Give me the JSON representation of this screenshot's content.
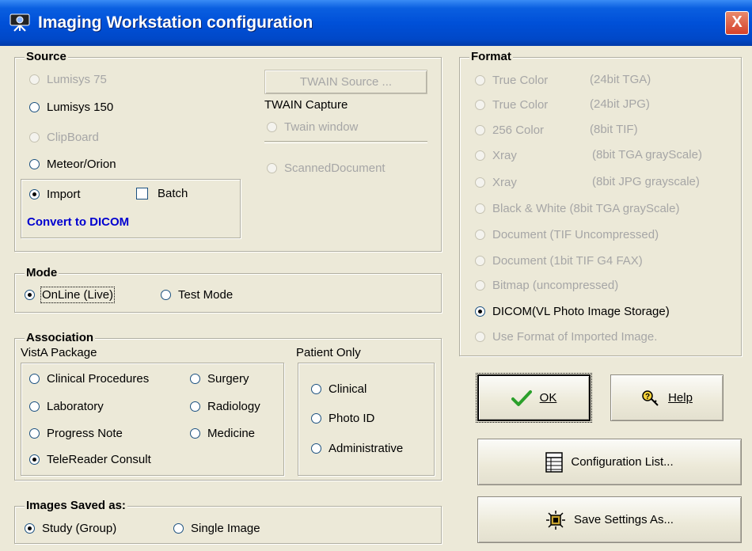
{
  "window": {
    "title": "Imaging Workstation configuration",
    "close": "X"
  },
  "source": {
    "legend": "Source",
    "options": [
      "Lumisys 75",
      "Lumisys 150",
      "ClipBoard",
      "Meteor/Orion",
      "Import"
    ],
    "batch_label": "Batch",
    "convert_label": "Convert to DICOM",
    "twain_source_button": "TWAIN Source ...",
    "twain_capture_label": "TWAIN Capture",
    "twain_window": "Twain window",
    "scanned_document": "ScannedDocument"
  },
  "format": {
    "legend": "Format",
    "options": [
      {
        "name": "True Color",
        "desc": "(24bit TGA)"
      },
      {
        "name": "True Color",
        "desc": "(24bit JPG)"
      },
      {
        "name": "256 Color",
        "desc": "(8bit TIF)"
      },
      {
        "name": "Xray",
        "desc": "(8bit TGA grayScale)"
      },
      {
        "name": "Xray",
        "desc": "(8bit JPG grayscale)"
      },
      {
        "name": "Black & White (8bit TGA grayScale)",
        "desc": ""
      },
      {
        "name": "Document (TIF Uncompressed)",
        "desc": ""
      },
      {
        "name": "Document (1bit TIF G4 FAX)",
        "desc": ""
      },
      {
        "name": "Bitmap (uncompressed)",
        "desc": ""
      },
      {
        "name": "DICOM(VL Photo Image Storage)",
        "desc": ""
      },
      {
        "name": "Use Format of Imported Image.",
        "desc": ""
      }
    ]
  },
  "mode": {
    "legend": "Mode",
    "online": "OnLine (Live)",
    "test": "Test Mode"
  },
  "association": {
    "legend": "Association",
    "vista_label": "VistA Package",
    "patient_label": "Patient Only",
    "packages": [
      "Clinical Procedures",
      "Surgery",
      "Laboratory",
      "Radiology",
      "Progress Note",
      "Medicine",
      "TeleReader Consult"
    ],
    "patient_options": [
      "Clinical",
      "Photo ID",
      "Administrative"
    ]
  },
  "images_saved": {
    "legend": "Images Saved as:",
    "study": "Study (Group)",
    "single": "Single Image"
  },
  "buttons": {
    "ok": "OK",
    "help": "Help",
    "config_list": "Configuration List...",
    "save_settings": "Save Settings As..."
  },
  "colors": {
    "title_bar": "#0050d8",
    "dialog_bg": "#ece9d8",
    "convert_link": "#0000d0",
    "ok_check": "#2ba02b"
  }
}
